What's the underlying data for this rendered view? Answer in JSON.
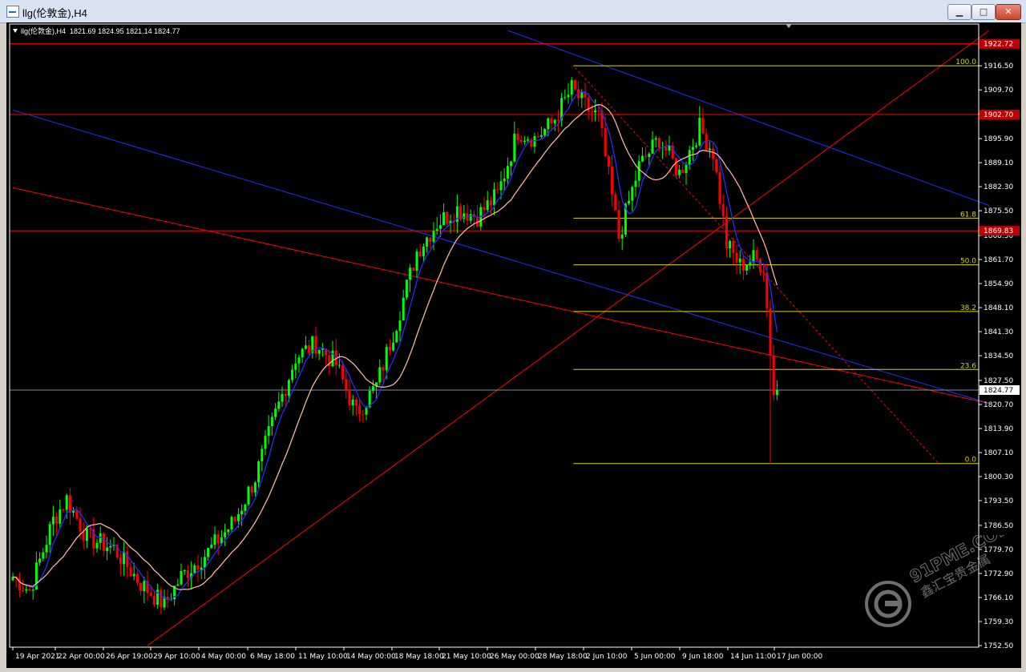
{
  "window": {
    "title": "llg(伦敦金),H4",
    "min_label": "▁",
    "max_label": "□",
    "close_label": "✕"
  },
  "info": {
    "symbol": "llg(伦敦金),H4",
    "ohlc": "1821.69 1824.95 1821.14 1824.77"
  },
  "watermark": {
    "domain": "91PME.COM",
    "name": "鑫汇宝贵金属"
  },
  "colors": {
    "background": "#000000",
    "bull": "#00ff00",
    "bear": "#ff0000",
    "fast_ma": "#1e2fff",
    "slow_ma": "#f7b69a",
    "fib": "#d6d600",
    "channel": "#1e2fff",
    "trendline": "#ff0000",
    "hline": "#ff0000",
    "price_line": "#7b8da8"
  },
  "chart_data": {
    "type": "candlestick",
    "symbol": "llg(伦敦金)",
    "timeframe": "H4",
    "ylim": [
      1752.5,
      1926.5
    ],
    "y_ticks": [
      1916.5,
      1909.7,
      1902.9,
      1895.9,
      1889.1,
      1882.3,
      1875.5,
      1868.5,
      1861.7,
      1854.9,
      1848.1,
      1841.3,
      1834.5,
      1827.5,
      1820.7,
      1813.9,
      1807.1,
      1800.3,
      1793.5,
      1786.5,
      1779.7,
      1772.9,
      1766.1,
      1759.3,
      1752.5
    ],
    "x_ticks": [
      "19 Apr 2021",
      "22 Apr 00:00",
      "26 Apr 19:00",
      "29 Apr 10:00",
      "4 May 00:00",
      "6 May 18:00",
      "11 May 10:00",
      "14 May 00:00",
      "18 May 18:00",
      "21 May 10:00",
      "26 May 00:00",
      "28 May 18:00",
      "2 Jun 10:00",
      "5 Jun 00:00",
      "9 Jun 18:00",
      "14 Jun 11:00",
      "17 Jun 00:00"
    ],
    "current_price": 1824.77,
    "horizontal_levels": [
      1922.72,
      1902.7,
      1869.83
    ],
    "fibonacci": {
      "high": 1916.5,
      "low": 1804.0,
      "levels": [
        {
          "label": "100.0",
          "value": 1916.5
        },
        {
          "label": "61.8",
          "value": 1873.4
        },
        {
          "label": "50.0",
          "value": 1860.2
        },
        {
          "label": "38.2",
          "value": 1847.0
        },
        {
          "label": "23.6",
          "value": 1830.6
        },
        {
          "label": "0.0",
          "value": 1804.0
        }
      ]
    },
    "anchors": [
      {
        "i": 0,
        "v": 1772
      },
      {
        "i": 5,
        "v": 1768
      },
      {
        "i": 12,
        "v": 1788
      },
      {
        "i": 16,
        "v": 1794
      },
      {
        "i": 22,
        "v": 1783
      },
      {
        "i": 30,
        "v": 1780
      },
      {
        "i": 38,
        "v": 1770
      },
      {
        "i": 45,
        "v": 1764
      },
      {
        "i": 50,
        "v": 1772
      },
      {
        "i": 58,
        "v": 1779
      },
      {
        "i": 66,
        "v": 1788
      },
      {
        "i": 72,
        "v": 1800
      },
      {
        "i": 78,
        "v": 1818
      },
      {
        "i": 84,
        "v": 1834
      },
      {
        "i": 90,
        "v": 1838
      },
      {
        "i": 96,
        "v": 1832
      },
      {
        "i": 102,
        "v": 1818
      },
      {
        "i": 108,
        "v": 1826
      },
      {
        "i": 114,
        "v": 1844
      },
      {
        "i": 120,
        "v": 1864
      },
      {
        "i": 126,
        "v": 1872
      },
      {
        "i": 132,
        "v": 1876
      },
      {
        "i": 138,
        "v": 1874
      },
      {
        "i": 144,
        "v": 1880
      },
      {
        "i": 150,
        "v": 1898
      },
      {
        "i": 155,
        "v": 1896
      },
      {
        "i": 160,
        "v": 1900
      },
      {
        "i": 166,
        "v": 1910
      },
      {
        "i": 171,
        "v": 1904
      },
      {
        "i": 174,
        "v": 1902
      },
      {
        "i": 180,
        "v": 1868
      },
      {
        "i": 186,
        "v": 1888
      },
      {
        "i": 192,
        "v": 1896
      },
      {
        "i": 198,
        "v": 1886
      },
      {
        "i": 204,
        "v": 1899
      },
      {
        "i": 208,
        "v": 1892
      },
      {
        "i": 212,
        "v": 1866
      },
      {
        "i": 216,
        "v": 1860
      },
      {
        "i": 220,
        "v": 1862
      },
      {
        "i": 223,
        "v": 1860
      },
      {
        "i": 226,
        "v": 1824
      },
      {
        "i": 227,
        "v": 1824
      }
    ]
  }
}
